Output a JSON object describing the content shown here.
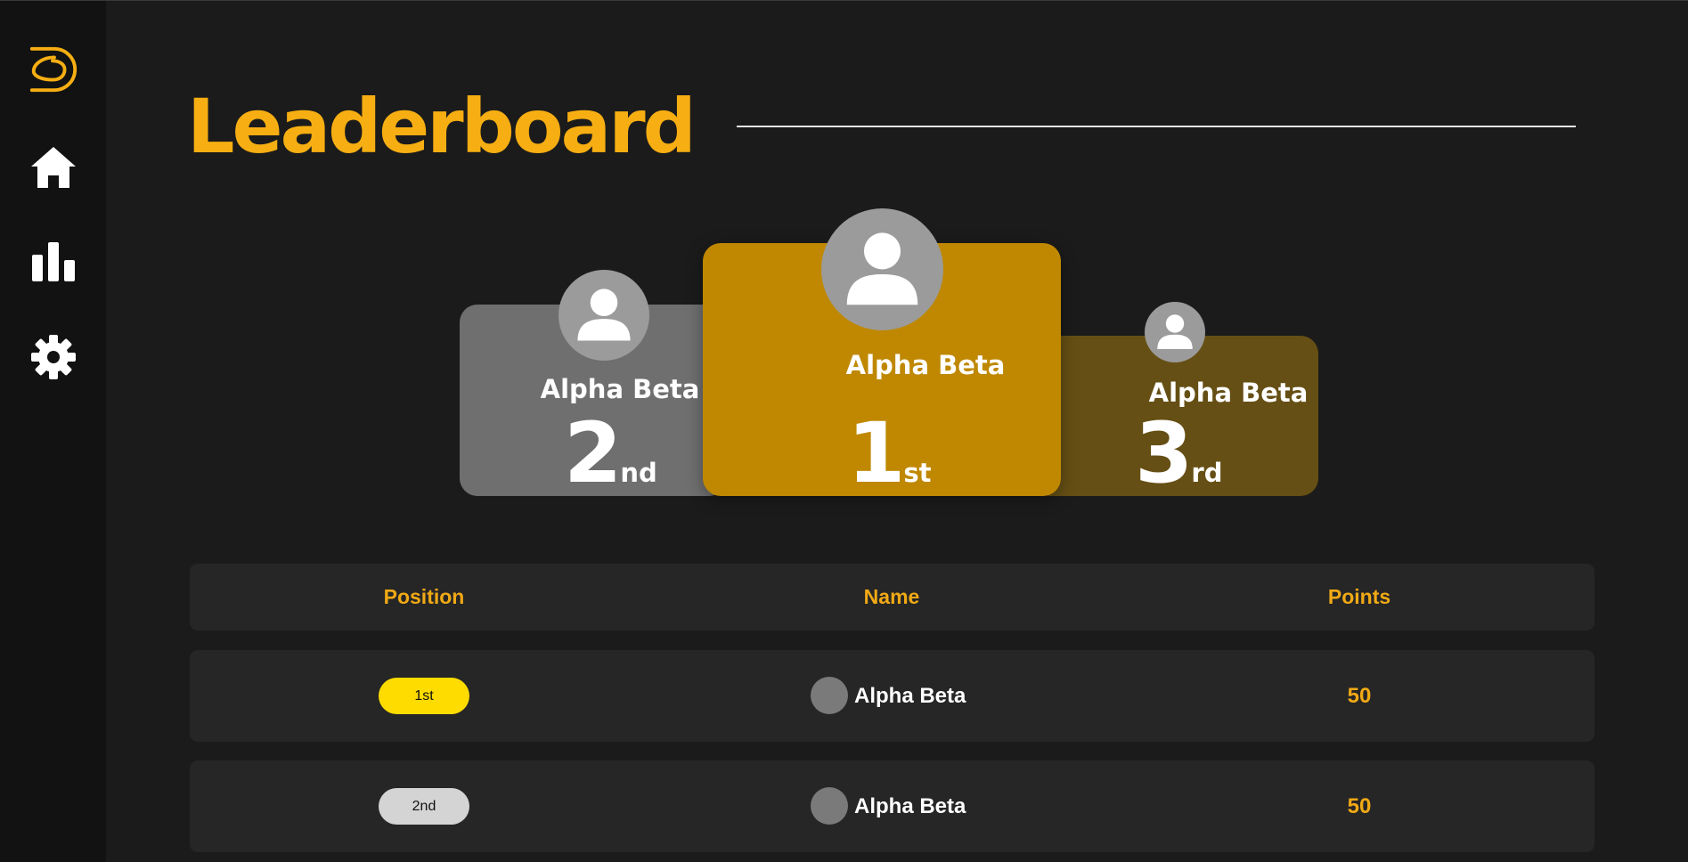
{
  "colors": {
    "accent": "#f6ae12",
    "first_card": "#bf8800",
    "second_card": "#6f6f6f",
    "third_card": "#654f14",
    "gold_badge": "#ffdc00",
    "silver_badge": "#d4d4d4"
  },
  "sidebar": {
    "logo_icon": "logo-icon",
    "items": [
      {
        "icon": "home-icon"
      },
      {
        "icon": "bar-chart-icon"
      },
      {
        "icon": "gear-icon"
      }
    ]
  },
  "header": {
    "title": "Leaderboard"
  },
  "podium": {
    "first": {
      "name": "Alpha Beta",
      "rank": "1",
      "suffix": "st"
    },
    "second": {
      "name": "Alpha Beta",
      "rank": "2",
      "suffix": "nd"
    },
    "third": {
      "name": "Alpha Beta",
      "rank": "3",
      "suffix": "rd"
    }
  },
  "table": {
    "headers": {
      "position": "Position",
      "name": "Name",
      "points": "Points"
    },
    "rows": [
      {
        "position": "1st",
        "name": "Alpha Beta",
        "points": "50"
      },
      {
        "position": "2nd",
        "name": "Alpha Beta",
        "points": "50"
      }
    ]
  }
}
